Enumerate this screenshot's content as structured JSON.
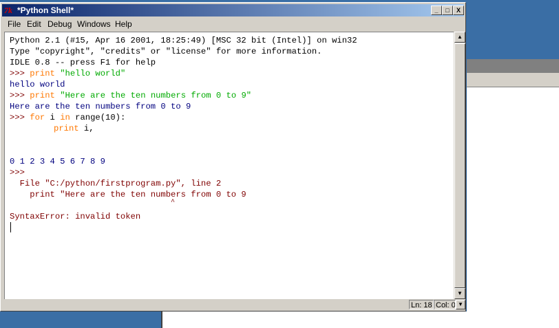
{
  "window": {
    "title": "*Python Shell*",
    "icon_text": "7k",
    "minimize": "_",
    "maximize": "□",
    "close": "X"
  },
  "menu": [
    "File",
    "Edit",
    "Debug",
    "Windows",
    "Help"
  ],
  "shell": {
    "line1": "Python 2.1 (#15, Apr 16 2001, 18:25:49) [MSC 32 bit (Intel)] on win32",
    "line2": "Type \"copyright\", \"credits\" or \"license\" for more information.",
    "line3": "IDLE 0.8 -- press F1 for help",
    "prompt": ">>>",
    "cmd1_kw": "print",
    "cmd1_str": "\"hello world\"",
    "out1": "hello world",
    "cmd2_kw": "print",
    "cmd2_str": "\"Here are the ten numbers from 0 to 9\"",
    "out2": "Here are the ten numbers from 0 to 9",
    "cmd3_for": "for",
    "cmd3_i": " i ",
    "cmd3_in": "in",
    "cmd3_rest": " range(10):",
    "cmd3_print": "print",
    "cmd3_print_rest": " i,",
    "out3": "0 1 2 3 4 5 6 7 8 9",
    "prompt_empty": ">>>",
    "err_file": "  File \"C:/python/firstprogram.py\", line 2",
    "err_code": "    print \"Here are the ten numbers from 0 to 9",
    "err_caret": "                                       ^",
    "err_msg": "SyntaxError: invalid token"
  },
  "scrollbar": {
    "up": "▲",
    "down": "▼"
  },
  "status": {
    "line": "Ln: 18",
    "col": "Col: 0"
  },
  "colors": {
    "output": "#00007f",
    "prompt": "#7f0000",
    "keyword": "#ff7700",
    "string": "#00aa00",
    "titlebar": "#0a246a"
  }
}
